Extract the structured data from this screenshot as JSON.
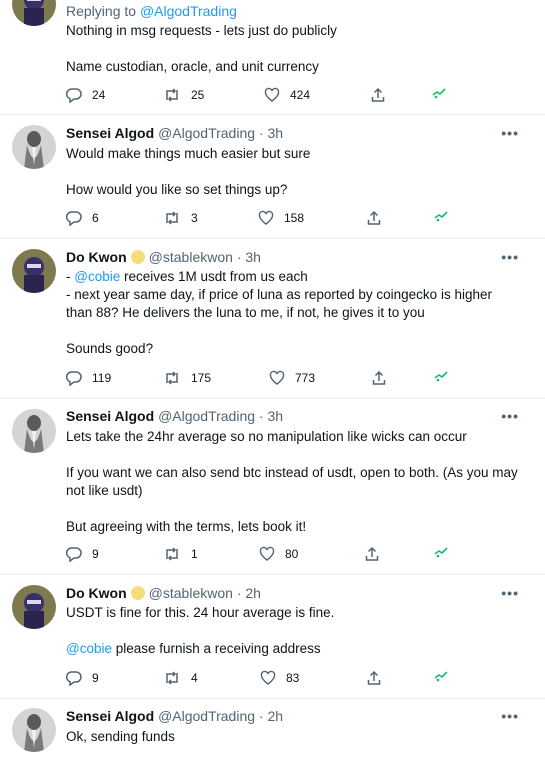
{
  "tweets": [
    {
      "reply_prefix": "Replying to ",
      "reply_to": "@AlgodTrading",
      "lines": [
        "Nothing in msg requests - lets just do publicly",
        "",
        "Name custodian, oracle, and unit currency"
      ],
      "replies": "24",
      "retweets": "25",
      "likes": "424"
    },
    {
      "name": "Sensei Algod",
      "handle": "@AlgodTrading",
      "time": "· 3h",
      "lines": [
        "Would make things much easier but sure",
        "",
        "How would you like so set things up?"
      ],
      "replies": "6",
      "retweets": "3",
      "likes": "158"
    },
    {
      "name": "Do Kwon",
      "handle": "@stablekwon",
      "time": "· 3h",
      "line1_mention": "@cobie",
      "line1_rest": " receives 1M usdt from us each",
      "line1_prefix": "- ",
      "line2": "- next year same day, if price of luna as reported by coingecko is higher",
      "line3": "than 88? He delivers the luna to me, if not, he gives it to you",
      "line4": "Sounds good?",
      "replies": "119",
      "retweets": "175",
      "likes": "773"
    },
    {
      "name": "Sensei Algod",
      "handle": "@AlgodTrading",
      "time": "· 3h",
      "line1": "Lets take the 24hr average so no manipulation like wicks can occur",
      "line2": "If you want we can also send btc instead of usdt, open to both. (As you may",
      "line3": "not like usdt)",
      "line4": "But agreeing with the terms, lets book it!",
      "replies": "9",
      "retweets": "1",
      "likes": "80"
    },
    {
      "name": "Do Kwon",
      "handle": "@stablekwon",
      "time": "· 2h",
      "line1": "USDT is fine for this. 24 hour average is fine.",
      "line2_mention": "@cobie",
      "line2_rest": " please furnish a receiving address",
      "replies": "9",
      "retweets": "4",
      "likes": "83"
    },
    {
      "name": "Sensei Algod",
      "handle": "@AlgodTrading",
      "time": "· 2h",
      "line1": "Ok, sending funds"
    }
  ],
  "more_label": "•••",
  "colors": {
    "link": "#1d9bf0",
    "muted": "#536471",
    "badge": "#f6dd79",
    "analytics": "#17bf63"
  }
}
